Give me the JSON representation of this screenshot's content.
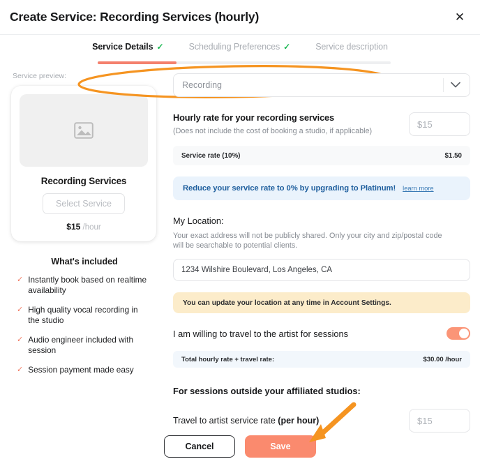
{
  "header": {
    "title": "Create Service: Recording Services (hourly)",
    "close_label": "✕"
  },
  "tabs": {
    "items": [
      {
        "label": "Service Details",
        "check": "✓",
        "active": true
      },
      {
        "label": "Scheduling Preferences",
        "check": "✓",
        "active": false
      },
      {
        "label": "Service description",
        "check": "",
        "active": false
      }
    ],
    "progress_percent": 27
  },
  "preview": {
    "section_label": "Service preview:",
    "thumb_icon": "image-placeholder-icon",
    "service_name": "Recording Services",
    "select_button": "Select Service",
    "price": "$15",
    "price_unit": "/hour"
  },
  "included": {
    "title": "What's included",
    "items": [
      "Instantly book based on realtime availability",
      "High quality vocal recording in the studio",
      "Audio engineer included with session",
      "Session payment made easy"
    ]
  },
  "form": {
    "category_value": "Recording",
    "hourly_rate_title": "Hourly rate for your recording services",
    "hourly_rate_sub": "(Does not include the cost of booking a studio, if applicable)",
    "hourly_rate_placeholder": "$15",
    "service_rate_label": "Service rate (10%)",
    "service_rate_value": "$1.50",
    "upgrade_text": "Reduce your service rate to 0% by upgrading to Platinum!",
    "upgrade_link": "learn more",
    "location_title": "My Location:",
    "location_note": "Your exact address will not be publicly shared. Only your city and zip/postal code will be searchable to potential clients.",
    "address_value": "1234 Wilshire Boulevard, Los Angeles, CA",
    "location_banner": "You can update your location at any time in Account Settings.",
    "travel_toggle_label": "I am willing to travel to the artist for sessions",
    "travel_toggle_on": true,
    "total_label": "Total hourly rate + travel rate:",
    "total_value": "$30.00 /hour",
    "outside_title": "For sessions outside your affiliated studios:",
    "travel_rate_label_plain": "Travel to artist service rate ",
    "travel_rate_label_bold": "(per hour)",
    "travel_rate_placeholder": "$15"
  },
  "footer": {
    "cancel_label": "Cancel",
    "save_label": "Save"
  },
  "colors": {
    "accent_salmon": "#fa8a6e",
    "annotation_orange": "#f59421",
    "check_green": "#1db954",
    "banner_blue_bg": "#eaf3fc",
    "banner_yellow_bg": "#fcecca"
  }
}
